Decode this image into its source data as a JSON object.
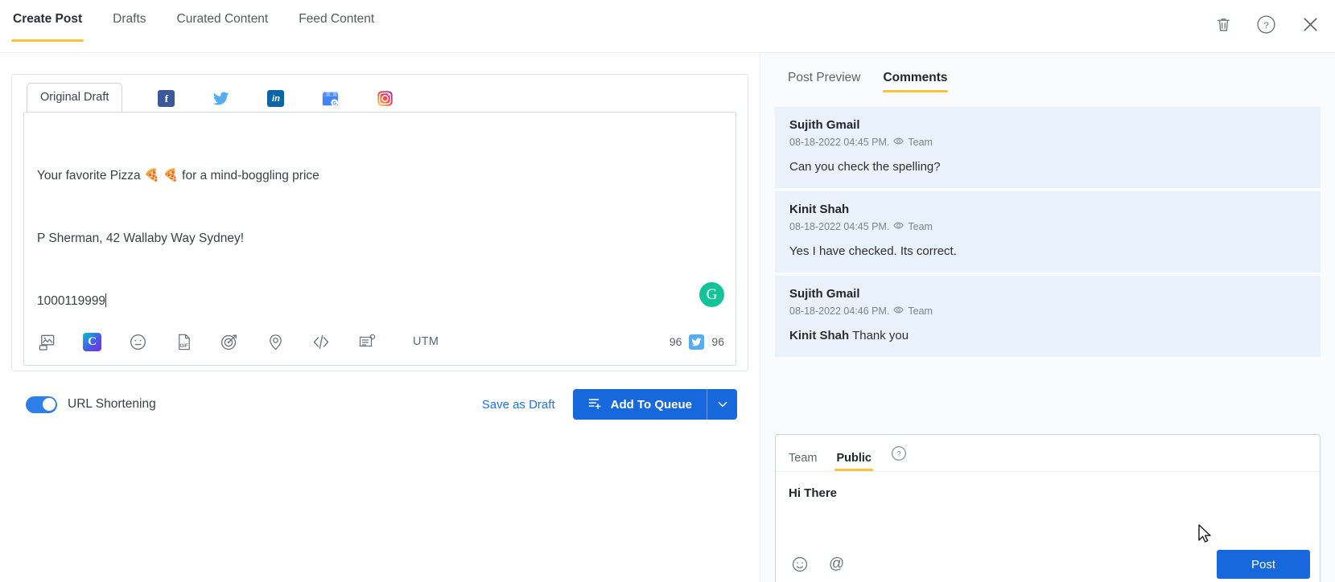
{
  "topnav": {
    "tabs": [
      {
        "label": "Create Post",
        "active": true
      },
      {
        "label": "Drafts",
        "active": false
      },
      {
        "label": "Curated Content",
        "active": false
      },
      {
        "label": "Feed Content",
        "active": false
      }
    ],
    "actions": [
      {
        "name": "delete-icon",
        "label": "Delete"
      },
      {
        "name": "help-icon",
        "label": "?"
      },
      {
        "name": "close-icon",
        "label": "Close"
      }
    ],
    "accent_color": "#fdc13a"
  },
  "editor": {
    "draft_tab_label": "Original Draft",
    "channels": [
      {
        "name": "facebook-icon",
        "label": "f"
      },
      {
        "name": "twitter-icon",
        "label": "Twitter"
      },
      {
        "name": "linkedin-icon",
        "label": "in"
      },
      {
        "name": "google-business-icon",
        "label": "G"
      },
      {
        "name": "instagram-icon",
        "label": "Instagram"
      }
    ],
    "content_lines": [
      "Your favorite Pizza 🍕 🍕 for a mind-boggling price",
      "P Sherman, 42 Wallaby Way Sydney!",
      "1000119999"
    ],
    "grammarly_label": "G",
    "toolbar": {
      "icons": [
        {
          "name": "image-upload-icon"
        },
        {
          "name": "canva-icon",
          "label": "C"
        },
        {
          "name": "emoji-icon"
        },
        {
          "name": "gif-icon",
          "label": "GIF"
        },
        {
          "name": "target-icon"
        },
        {
          "name": "location-icon"
        },
        {
          "name": "code-icon"
        },
        {
          "name": "note-icon"
        }
      ],
      "utm_label": "UTM",
      "char_count": "96",
      "twitter_count": "96"
    }
  },
  "actions": {
    "url_shortening_label": "URL Shortening",
    "url_shortening_on": true,
    "save_as_draft_label": "Save as Draft",
    "add_to_queue_label": "Add To Queue",
    "primary_color": "#1668dc"
  },
  "right_panel": {
    "tabs": [
      {
        "label": "Post Preview",
        "active": false
      },
      {
        "label": "Comments",
        "active": true
      }
    ],
    "comments": [
      {
        "author": "Sujith Gmail",
        "timestamp": "08-18-2022 04:45 PM.",
        "visibility": "Team",
        "body": "Can you check the spelling?",
        "mention": ""
      },
      {
        "author": "Kinit Shah",
        "timestamp": "08-18-2022 04:45 PM.",
        "visibility": "Team",
        "body": "Yes I have checked. Its correct.",
        "mention": ""
      },
      {
        "author": "Sujith Gmail",
        "timestamp": "08-18-2022 04:46 PM.",
        "visibility": "Team",
        "body": " Thank you",
        "mention": "Kinit Shah"
      }
    ],
    "composer": {
      "tabs": [
        {
          "label": "Team",
          "active": false
        },
        {
          "label": "Public",
          "active": true
        }
      ],
      "help_label": "?",
      "text": "Hi There",
      "emoji_icon": "emoji-icon",
      "mention_icon": "mention-icon",
      "mention_glyph": "@",
      "post_label": "Post"
    }
  }
}
